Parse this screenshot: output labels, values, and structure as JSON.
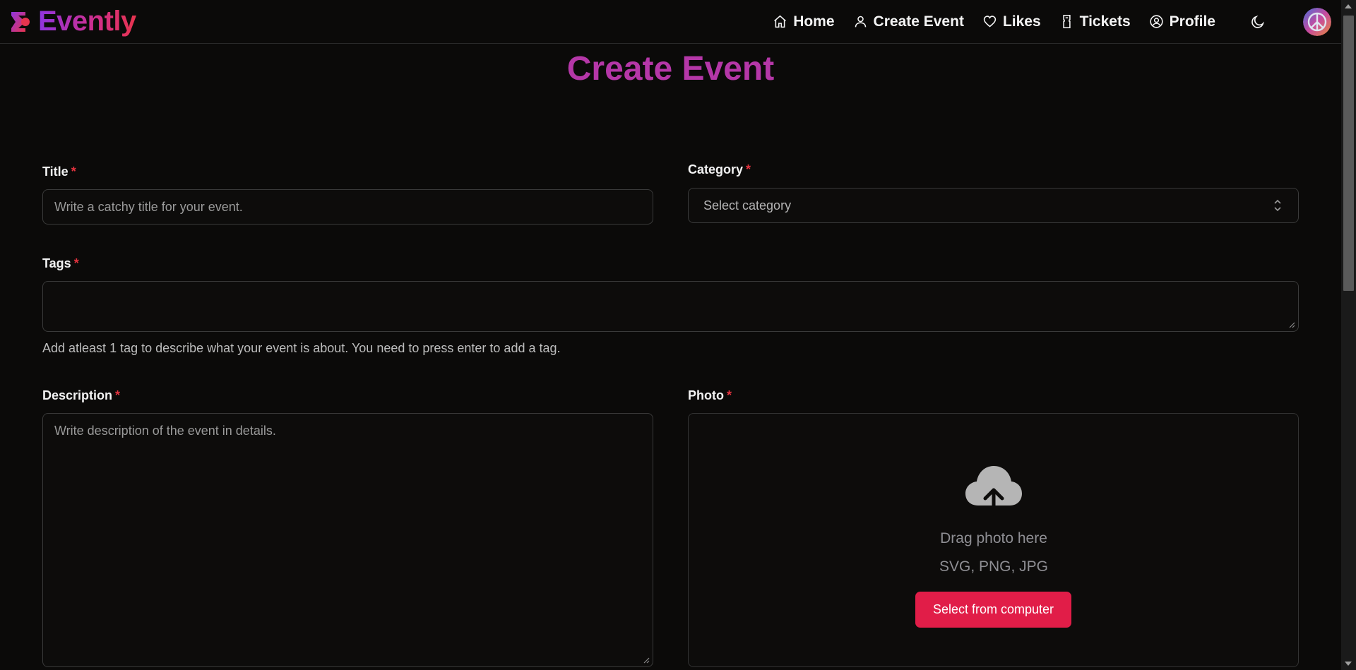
{
  "brand": {
    "name": "Evently"
  },
  "nav": {
    "items": [
      {
        "label": "Home",
        "icon": "home-icon"
      },
      {
        "label": "Create Event",
        "icon": "user-icon"
      },
      {
        "label": "Likes",
        "icon": "heart-icon"
      },
      {
        "label": "Tickets",
        "icon": "ticket-icon"
      },
      {
        "label": "Profile",
        "icon": "user-circle-icon"
      }
    ],
    "theme_icon": "moon-icon"
  },
  "page": {
    "title": "Create Event"
  },
  "form": {
    "title": {
      "label": "Title",
      "required": "*",
      "placeholder": "Write a catchy title for your event.",
      "value": ""
    },
    "category": {
      "label": "Category",
      "required": "*",
      "selected": "Select category"
    },
    "tags": {
      "label": "Tags",
      "required": "*",
      "value": "",
      "helper": "Add atleast 1 tag to describe what your event is about. You need to press enter to add a tag."
    },
    "description": {
      "label": "Description",
      "required": "*",
      "placeholder": "Write description of the event in details.",
      "value": ""
    },
    "photo": {
      "label": "Photo",
      "required": "*",
      "drop_text": "Drag photo here",
      "formats": "SVG, PNG, JPG",
      "button_label": "Select from computer"
    }
  },
  "colors": {
    "accent": "#e11d48",
    "title": "#b537a8",
    "background": "#0b0a09",
    "required": "#e5333f"
  }
}
